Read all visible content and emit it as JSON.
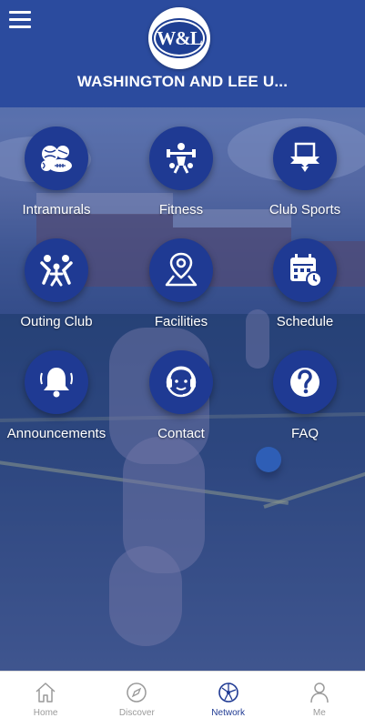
{
  "header": {
    "logo_text": "W&L",
    "title": "WASHINGTON AND LEE U..."
  },
  "tiles": [
    {
      "label": "Intramurals",
      "icon": "sports-balls-icon"
    },
    {
      "label": "Fitness",
      "icon": "weightlifter-icon"
    },
    {
      "label": "Club Sports",
      "icon": "pennant-shield-icon"
    },
    {
      "label": "Outing Club",
      "icon": "people-group-icon"
    },
    {
      "label": "Facilities",
      "icon": "map-pin-icon"
    },
    {
      "label": "Schedule",
      "icon": "calendar-clock-icon"
    },
    {
      "label": "Announcements",
      "icon": "bell-icon"
    },
    {
      "label": "Contact",
      "icon": "headset-person-icon"
    },
    {
      "label": "FAQ",
      "icon": "question-mark-icon"
    }
  ],
  "tabbar": [
    {
      "label": "Home",
      "icon": "home-icon",
      "active": false
    },
    {
      "label": "Discover",
      "icon": "compass-icon",
      "active": false
    },
    {
      "label": "Network",
      "icon": "network-globe-icon",
      "active": true
    },
    {
      "label": "Me",
      "icon": "person-icon",
      "active": false
    }
  ],
  "colors": {
    "primary": "#1f3a93",
    "header": "#2b4b9e",
    "inactive_tab": "#9a9a9a"
  }
}
